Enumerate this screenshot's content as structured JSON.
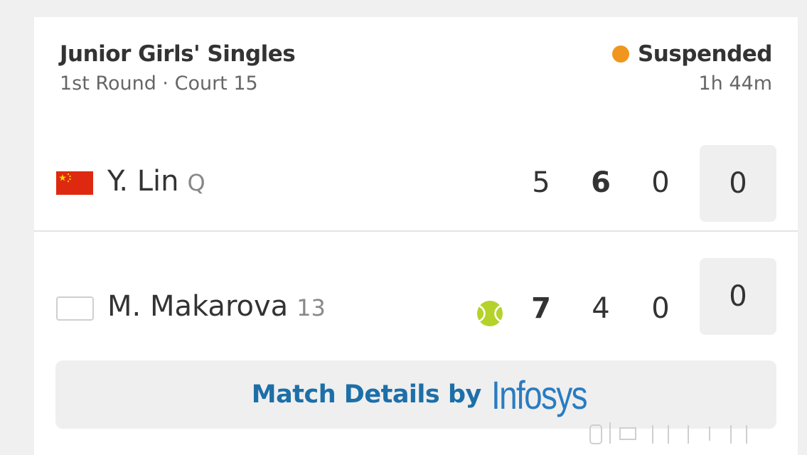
{
  "match": {
    "event": "Junior Girls' Singles",
    "round_court": "1st Round · Court 15",
    "status": "Suspended",
    "status_color": "#f0961e",
    "duration": "1h 44m"
  },
  "players": [
    {
      "name": "Y. Lin",
      "seed": "Q",
      "flag": "china-flag-icon",
      "serving": false,
      "sets": [
        "5",
        "6",
        "0"
      ],
      "bold_sets": [
        false,
        true,
        false
      ],
      "game": "0"
    },
    {
      "name": "M. Makarova",
      "seed": "13",
      "flag": "blank-flag-icon",
      "serving": true,
      "sets": [
        "7",
        "4",
        "0"
      ],
      "bold_sets": [
        true,
        false,
        false
      ],
      "game": "0"
    }
  ],
  "footer": {
    "label": "Match Details by",
    "brand": "Infosys",
    "brand_color": "#2a7cc0"
  }
}
